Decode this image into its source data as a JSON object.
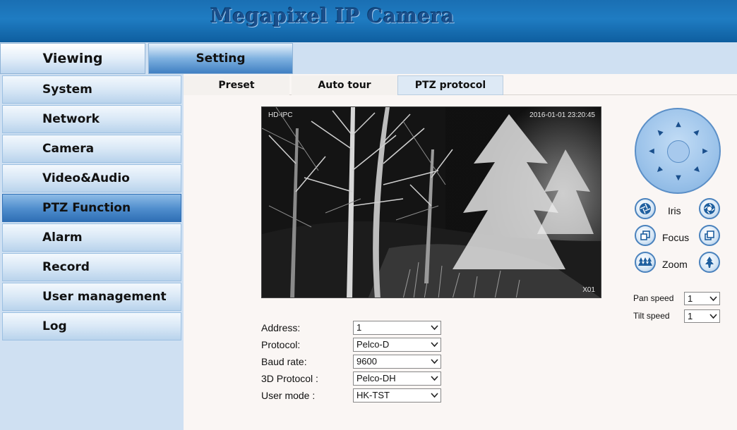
{
  "header": {
    "title": "Megapixel IP Camera"
  },
  "main_tabs": {
    "viewing": "Viewing",
    "setting": "Setting"
  },
  "sidebar": {
    "items": [
      {
        "label": "System"
      },
      {
        "label": "Network"
      },
      {
        "label": "Camera"
      },
      {
        "label": "Video&Audio"
      },
      {
        "label": "PTZ Function",
        "active": true
      },
      {
        "label": "Alarm"
      },
      {
        "label": "Record"
      },
      {
        "label": "User management"
      },
      {
        "label": "Log"
      }
    ]
  },
  "subtabs": {
    "preset": "Preset",
    "auto_tour": "Auto tour",
    "ptz_protocol": "PTZ protocol",
    "active": "ptz_protocol"
  },
  "video": {
    "osd_name": "HD-IPC",
    "osd_time": "2016-01-01   23:20:45",
    "osd_channel": "X01"
  },
  "ptz": {
    "iris_label": "Iris",
    "focus_label": "Focus",
    "zoom_label": "Zoom",
    "pan_speed_label": "Pan speed",
    "pan_speed_value": "1",
    "tilt_speed_label": "Tilt speed",
    "tilt_speed_value": "1"
  },
  "form": {
    "address_label": "Address:",
    "address_value": "1",
    "protocol_label": "Protocol:",
    "protocol_value": "Pelco-D",
    "baud_label": "Baud rate:",
    "baud_value": "9600",
    "protocol3d_label": "3D Protocol :",
    "protocol3d_value": "Pelco-DH",
    "usermode_label": "User mode :",
    "usermode_value": "HK-TST"
  },
  "colors": {
    "header_blue": "#1f7cc2",
    "active_blue": "#4e8ccc",
    "title_blue": "#1a4f8c"
  }
}
